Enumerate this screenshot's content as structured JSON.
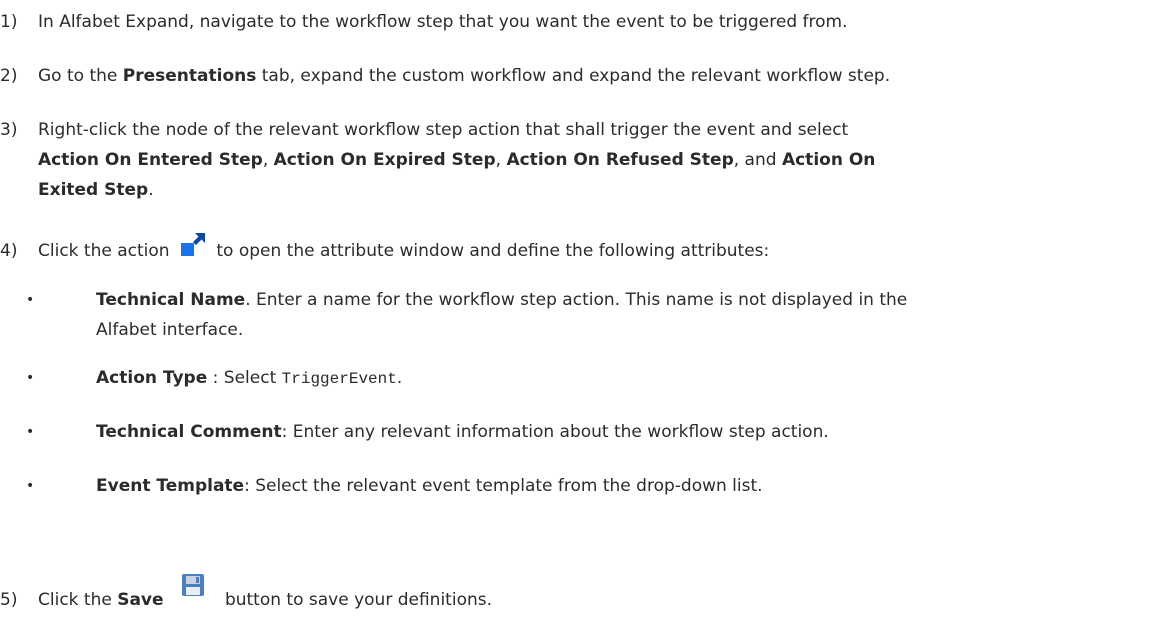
{
  "steps": [
    {
      "num": "1)",
      "text": "In Alfabet Expand, navigate to the workflow step that you want the event to be triggered from."
    },
    {
      "num": "2)",
      "pre": "Go to the ",
      "bold": "Presentations",
      "post": " tab, expand the custom workflow and expand the relevant workflow step."
    },
    {
      "num": "3)",
      "line1": "Right-click the node of the relevant workflow step action that shall trigger the event and select",
      "b1": "Action On Entered Step",
      "sep1": ", ",
      "b2": "Action On Expired Step",
      "sep2": ", ",
      "b3": "Action On Refused Step",
      "sep3": ", and ",
      "b4a": "Action On",
      "b4b": "Exited Step",
      "end": "."
    },
    {
      "num": "4)",
      "pre": "Click the action ",
      "post": " to open the attribute window and define the following attributes:",
      "icon": "edit-attributes-icon"
    },
    {
      "num": "5)",
      "pre": "Click the ",
      "bold": "Save",
      "post": " button to save your definitions.",
      "icon": "save-icon"
    }
  ],
  "bullets": [
    {
      "bold": "Technical Name",
      "text_line1": ". Enter a name for the workflow step action. This name is not displayed in the",
      "text_line2": "Alfabet interface."
    },
    {
      "bold": "Action Type",
      "text": " : Select ",
      "code": "TriggerEvent",
      "end": "."
    },
    {
      "bold": "Technical Comment",
      "text": ": Enter any relevant information about the workflow step action."
    },
    {
      "bold": "Event Template",
      "text": ": Select the relevant event template from the drop-down list."
    }
  ],
  "bullet_char": "•",
  "colors": {
    "text": "#2b2b2b",
    "icon_blue": "#1a73e8",
    "icon_blue_dark": "#0d47a1",
    "save_blue": "#4a7fc0",
    "save_grey": "#c9d3df"
  }
}
